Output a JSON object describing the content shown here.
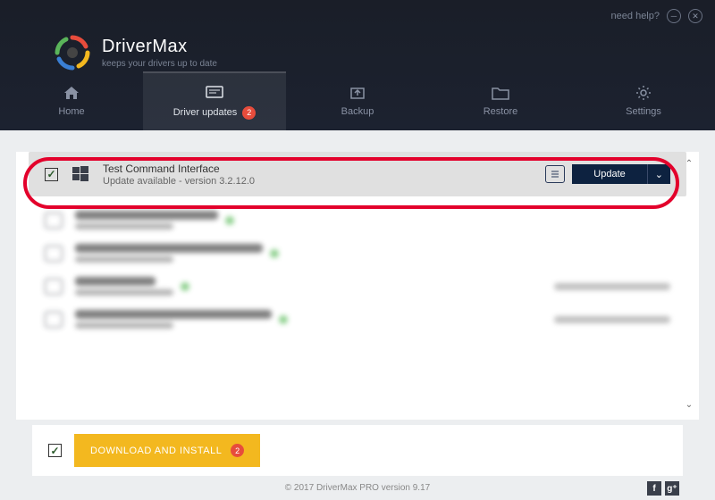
{
  "titlebar": {
    "help": "need help?"
  },
  "brand": {
    "title": "DriverMax",
    "subtitle": "keeps your drivers up to date"
  },
  "tabs": [
    {
      "label": "Home"
    },
    {
      "label": "Driver updates",
      "badge": "2"
    },
    {
      "label": "Backup"
    },
    {
      "label": "Restore"
    },
    {
      "label": "Settings"
    }
  ],
  "featured": {
    "title": "Test Command Interface",
    "subtitle": "Update available - version 3.2.12.0",
    "button": "Update"
  },
  "blurred_rows": [
    {
      "title": "NVIDIA GeForce 210",
      "sub": "This driver is up-to-date"
    },
    {
      "title": "High Definition Audio Device",
      "sub": "This driver is up-to-date"
    },
    {
      "title": "Intel Device",
      "sub": "",
      "right": "Driver updated on 03-Nov-16"
    },
    {
      "title": "Intel(R) 82801 PCI Bridge - 244E",
      "sub": "",
      "right": "Driver updated on 03-Nov-16"
    }
  ],
  "footer": {
    "install": "DOWNLOAD AND INSTALL",
    "install_badge": "2"
  },
  "bottom": {
    "copyright": "© 2017 DriverMax PRO version 9.17"
  }
}
